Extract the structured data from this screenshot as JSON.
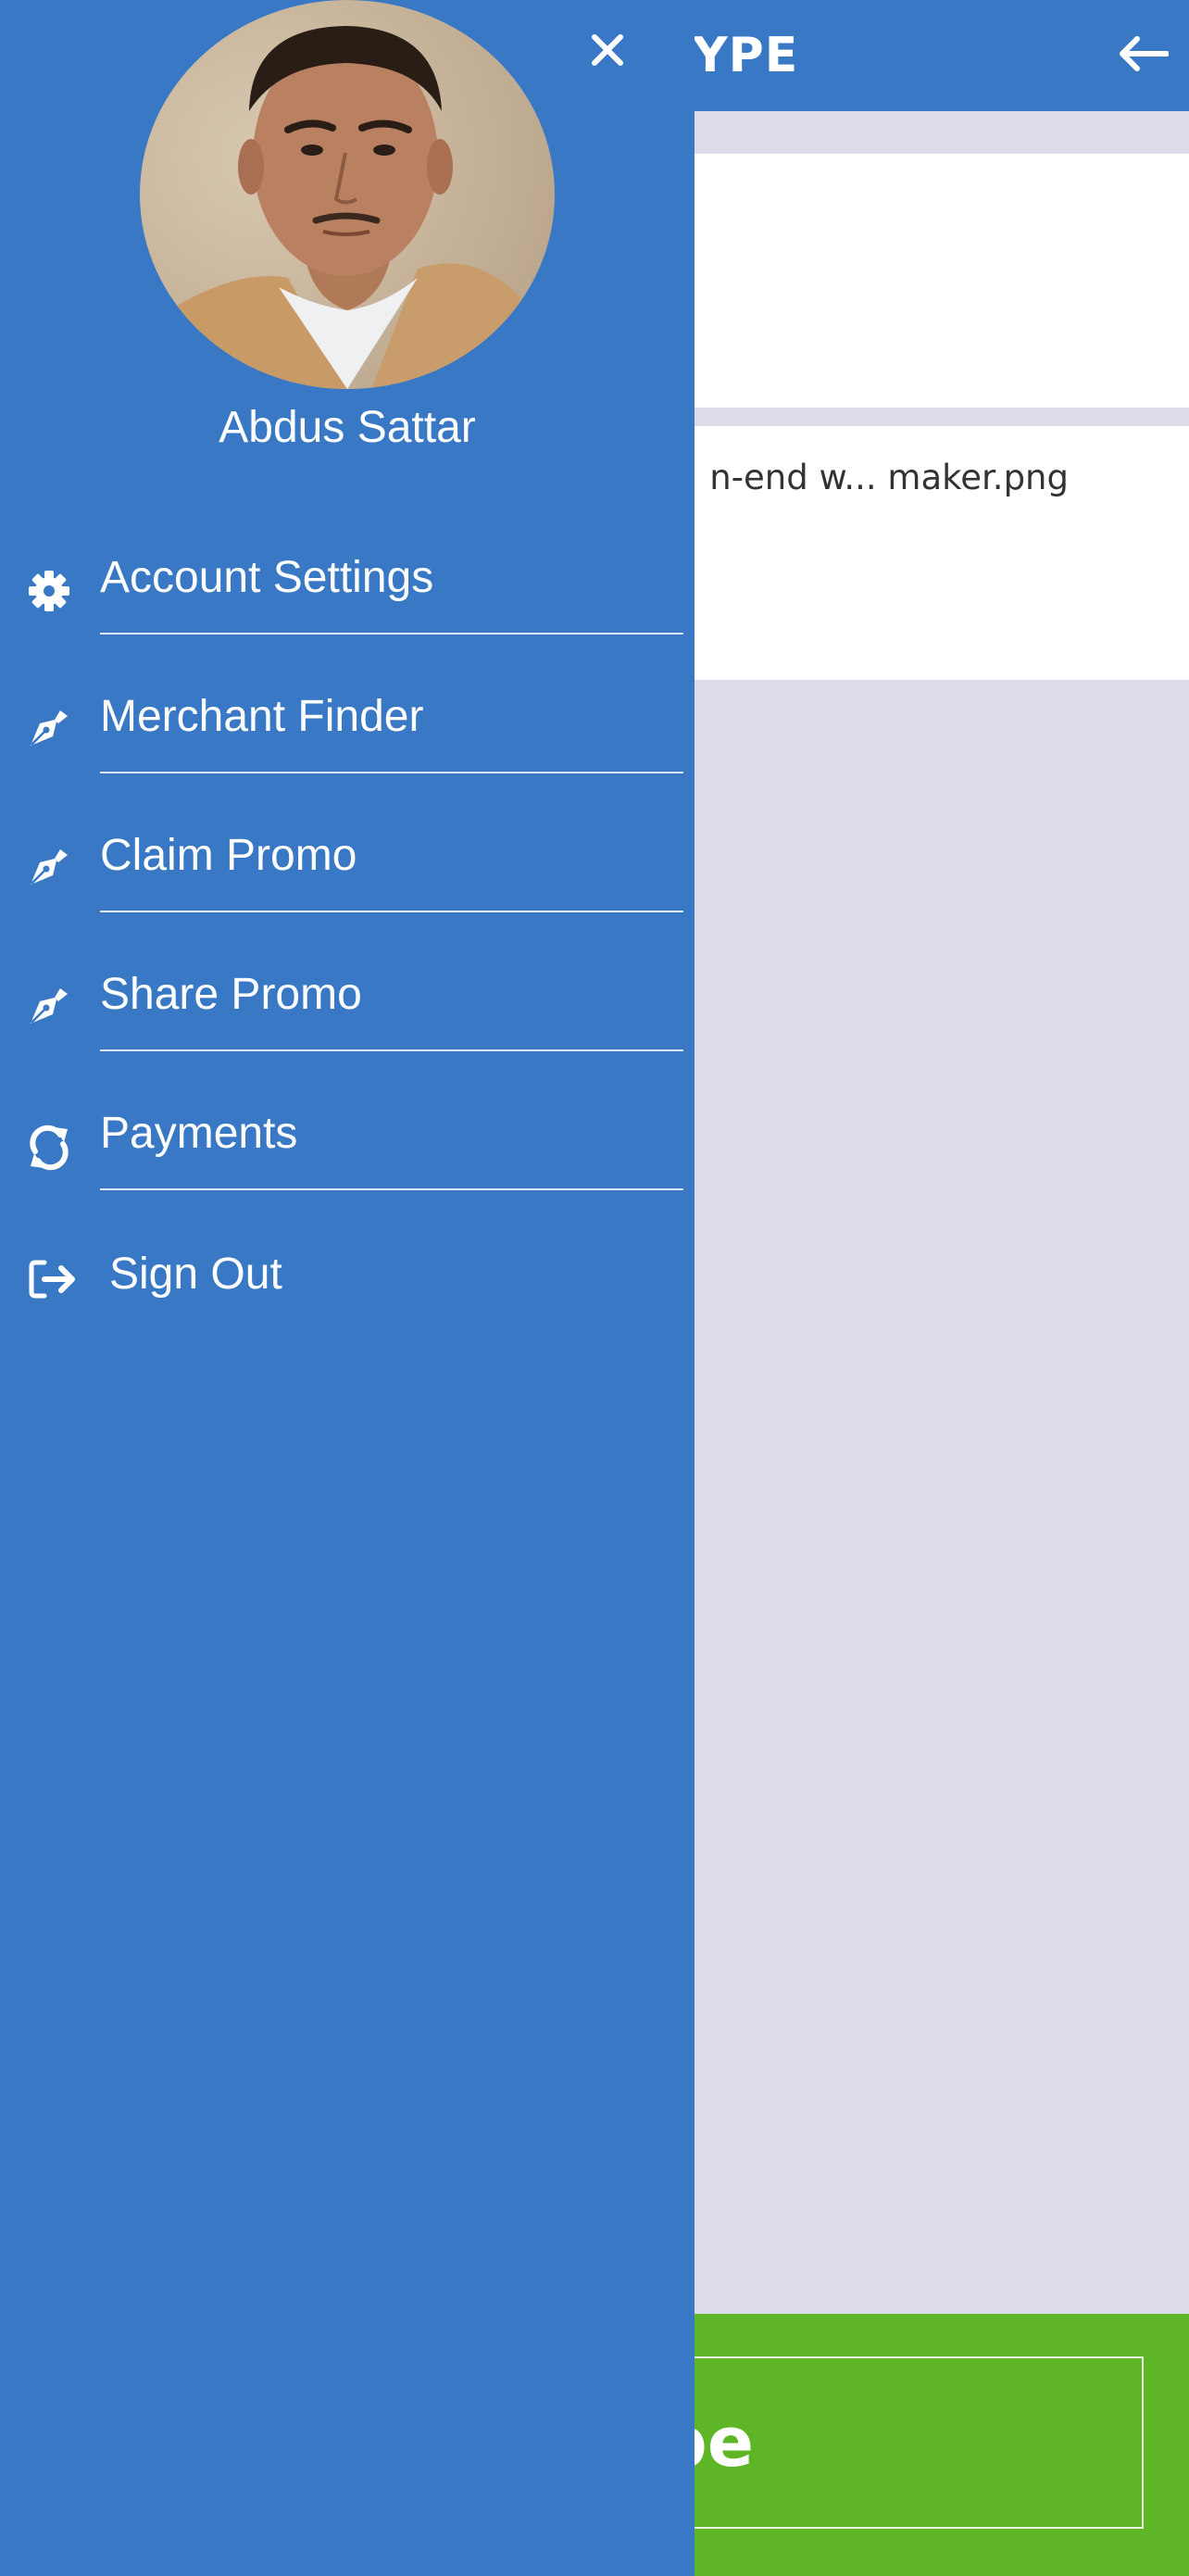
{
  "header": {
    "title": "YPE"
  },
  "content": {
    "file_name": "n-end w... maker.png"
  },
  "footer": {
    "button_label": "ent Type"
  },
  "drawer": {
    "user_name": "Abdus Sattar",
    "menu": [
      {
        "label": "Account Settings",
        "icon": "gear-icon"
      },
      {
        "label": "Merchant Finder",
        "icon": "pen-nib-icon"
      },
      {
        "label": "Claim Promo",
        "icon": "pen-nib-icon"
      },
      {
        "label": "Share Promo",
        "icon": "pen-nib-icon"
      },
      {
        "label": "Payments",
        "icon": "refresh-icon"
      },
      {
        "label": "Sign Out",
        "icon": "sign-out-icon"
      }
    ]
  },
  "colors": {
    "primary": "#3878c5",
    "background": "#dedbe9",
    "accent_green": "#5eb526",
    "text_light": "#ffffff"
  }
}
